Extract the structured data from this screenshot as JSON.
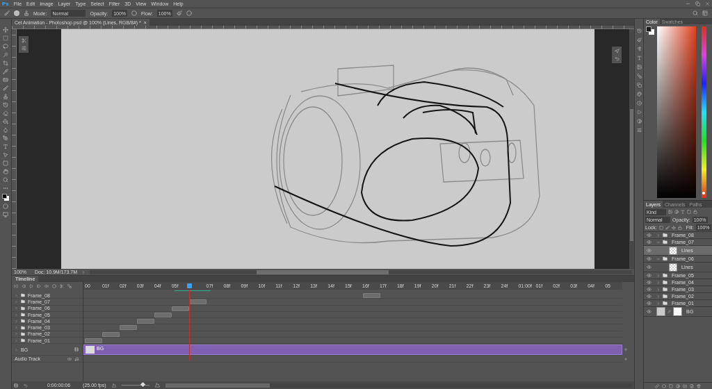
{
  "app": {
    "logo": "Ps"
  },
  "menu": [
    "File",
    "Edit",
    "Image",
    "Layer",
    "Type",
    "Select",
    "Filter",
    "3D",
    "View",
    "Window",
    "Help"
  ],
  "options": {
    "mode_label": "Mode:",
    "mode": "Normal",
    "opacity_label": "Opacity:",
    "opacity": "100%",
    "flow_label": "Flow:",
    "flow": "100%"
  },
  "document": {
    "tab": "Cel Animation - Photoshop.psd @ 100% (Lines, RGB/8#) *",
    "close": "×",
    "zoom": "100%",
    "doc_size": "Doc: 10.9M/173.7M"
  },
  "timeline": {
    "title": "Timeline",
    "ticks": [
      {
        "label": "00",
        "current": false
      },
      {
        "label": "01f",
        "current": false
      },
      {
        "label": "02f",
        "current": false
      },
      {
        "label": "03f",
        "current": false
      },
      {
        "label": "04f",
        "current": false
      },
      {
        "label": "05f",
        "current": false
      },
      {
        "current": true
      },
      {
        "label": "07f",
        "current": false
      },
      {
        "label": "08f",
        "current": false
      },
      {
        "label": "09f",
        "current": false
      },
      {
        "label": "10f",
        "current": false
      },
      {
        "label": "11f",
        "current": false
      },
      {
        "label": "12f",
        "current": false
      },
      {
        "label": "13f",
        "current": false
      },
      {
        "label": "14f",
        "current": false
      },
      {
        "label": "15f",
        "current": false
      },
      {
        "label": "16f",
        "current": false
      },
      {
        "label": "17f",
        "current": false
      },
      {
        "label": "18f",
        "current": false
      },
      {
        "label": "19f",
        "current": false
      },
      {
        "label": "20f",
        "current": false
      },
      {
        "label": "21f",
        "current": false
      },
      {
        "label": "22f",
        "current": false
      },
      {
        "label": "23f",
        "current": false
      },
      {
        "label": "24f",
        "current": false
      },
      {
        "label": "01:00f",
        "current": false
      },
      {
        "label": "01f",
        "current": false
      },
      {
        "label": "02f",
        "current": false
      },
      {
        "label": "03f",
        "current": false
      },
      {
        "label": "04f",
        "current": false
      },
      {
        "label": "05",
        "current": false
      }
    ],
    "tracks": [
      {
        "name": "Frame_08",
        "level": 0.5333
      },
      {
        "name": "Frame_07",
        "level": 0.2
      },
      {
        "name": "Frame_06",
        "level": 0.1667
      },
      {
        "name": "Frame_05",
        "level": 0.1333
      },
      {
        "name": "Frame_04",
        "level": 0.1
      },
      {
        "name": "Frame_03",
        "level": 0.0667
      },
      {
        "name": "Frame_02",
        "level": 0.0333
      },
      {
        "name": "Frame_01",
        "level": 0
      }
    ],
    "bg_track": {
      "name": "BG",
      "clip_label": "BG"
    },
    "audio_track": "Audio Track",
    "current_time": "0:00:00:06",
    "fps": "(25.00 fps)",
    "zoom_slider": {
      "level": 0.75
    }
  },
  "color_panel": {
    "tabs": [
      {
        "label": "Color",
        "selected": true
      },
      {
        "label": "Swatches",
        "selected": false
      }
    ],
    "hue_slider": {
      "level": 0.02
    }
  },
  "layers_panel": {
    "tabs": [
      {
        "label": "Layers",
        "selected": true
      },
      {
        "label": "Channels",
        "selected": false
      },
      {
        "label": "Paths",
        "selected": false
      }
    ],
    "filter": "Kind",
    "blend": "Normal",
    "opacity_label": "Opacity:",
    "opacity": "100%",
    "lock_label": "Lock:",
    "fill_label": "Fill:",
    "fill": "100%",
    "layers": [
      {
        "kind": "group",
        "name": "Frame_08",
        "visible": true,
        "expanded": false,
        "selected": false
      },
      {
        "kind": "group",
        "name": "Frame_07",
        "visible": true,
        "expanded": true,
        "selected": false,
        "children": [
          {
            "kind": "pixel",
            "name": "Lines",
            "visible": true,
            "selected": true
          }
        ]
      },
      {
        "kind": "group",
        "name": "Frame_06",
        "visible": true,
        "expanded": true,
        "selected": false,
        "children": [
          {
            "kind": "pixel",
            "name": "Lines",
            "visible": true,
            "selected": false
          }
        ]
      },
      {
        "kind": "group",
        "name": "Frame_05",
        "visible": true,
        "expanded": false,
        "selected": false
      },
      {
        "kind": "group",
        "name": "Frame_04",
        "visible": true,
        "expanded": false,
        "selected": false
      },
      {
        "kind": "group",
        "name": "Frame_03",
        "visible": true,
        "expanded": false,
        "selected": false
      },
      {
        "kind": "group",
        "name": "Frame_02",
        "visible": true,
        "expanded": false,
        "selected": false
      },
      {
        "kind": "group",
        "name": "Frame_01",
        "visible": true,
        "expanded": false,
        "selected": false
      },
      {
        "kind": "masked",
        "name": "BG",
        "visible": true,
        "selected": false
      }
    ]
  }
}
